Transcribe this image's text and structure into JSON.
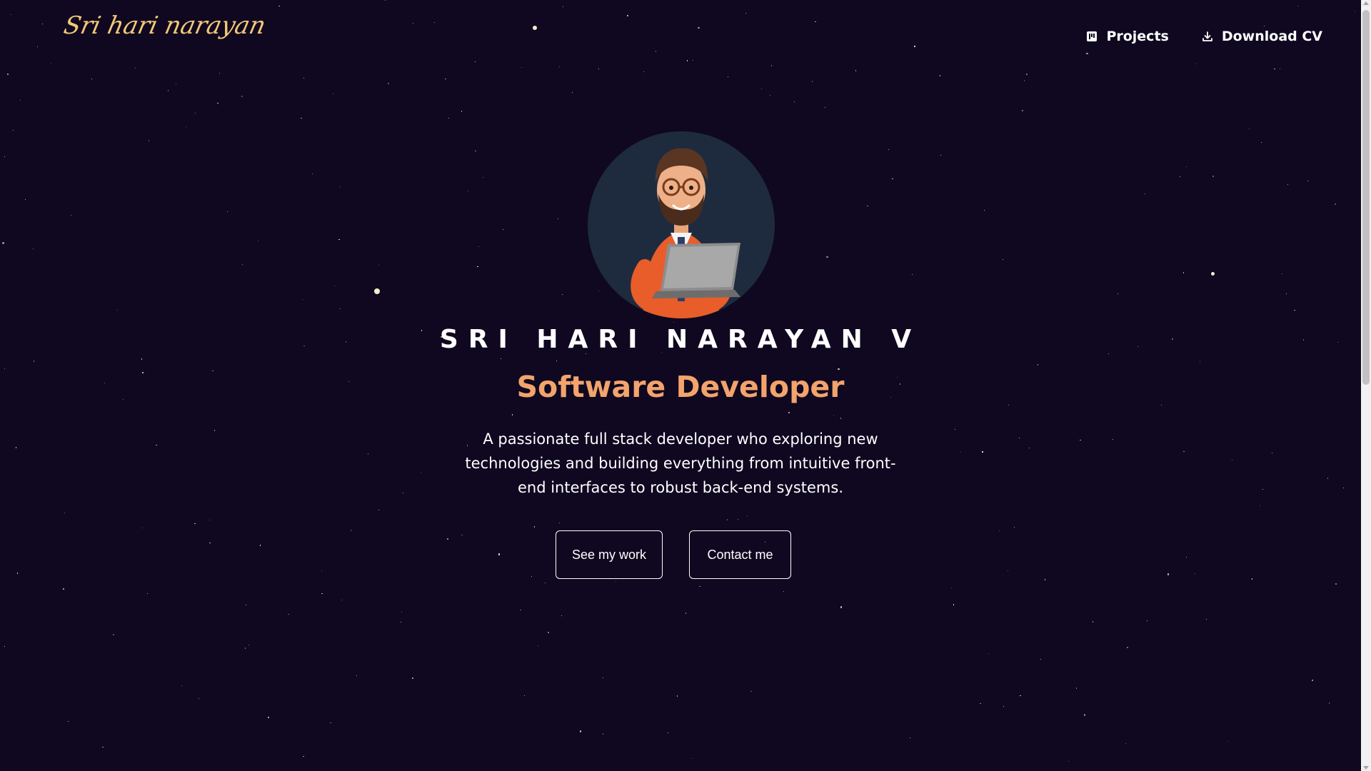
{
  "header": {
    "logo_text": "Sri hari narayan",
    "nav": [
      {
        "label": "Projects",
        "icon": "projects-icon"
      },
      {
        "label": "Download CV",
        "icon": "download-icon"
      }
    ]
  },
  "hero": {
    "avatar_icon": "developer-avatar",
    "name": "SRI HARI NARAYAN V",
    "role": "Software Developer",
    "description": "A passionate full stack developer who exploring new technologies and building everything from intuitive front-end interfaces to robust back-end systems.",
    "buttons": {
      "see_work": "See my work",
      "contact": "Contact me"
    }
  },
  "colors": {
    "background": "#0f0820",
    "accent": "#f3a36c",
    "logo": "#f2c877",
    "avatar_bg": "#1e2b3f"
  }
}
